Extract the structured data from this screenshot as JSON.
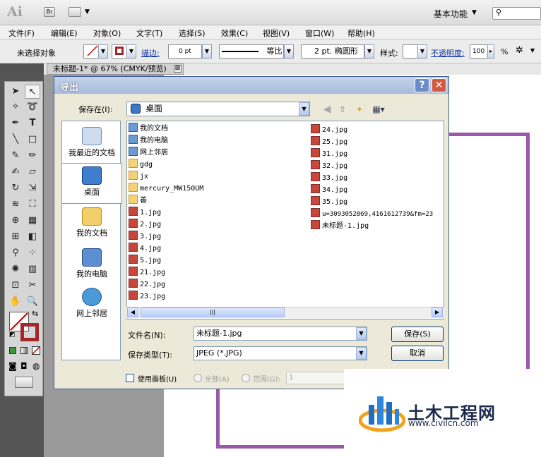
{
  "app": {
    "logo": "Ai",
    "bridge_label": "Br",
    "workspace": "基本功能"
  },
  "menu": [
    "文件(F)",
    "编辑(E)",
    "对象(O)",
    "文字(T)",
    "选择(S)",
    "效果(C)",
    "视图(V)",
    "窗口(W)",
    "帮助(H)"
  ],
  "control": {
    "selection": "未选择对象",
    "stroke_label": "描边:",
    "stroke_value": "0 pt",
    "profile": "等比",
    "brush": "2 pt. 椭圆形",
    "style_label": "样式:",
    "opacity_label": "不透明度:",
    "opacity_value": "100",
    "opacity_unit": "%"
  },
  "document": {
    "tab": "未标题-1* @ 67% (CMYK/预览)",
    "close": "⊠"
  },
  "dialog": {
    "title": "导出",
    "help": "?",
    "close": "✕",
    "save_in_label": "保存在(I):",
    "save_in_value": "桌面",
    "places": [
      {
        "label": "我最近的文档",
        "icon": "recent-docs-icon"
      },
      {
        "label": "桌面",
        "icon": "desktop-icon"
      },
      {
        "label": "我的文档",
        "icon": "my-documents-icon"
      },
      {
        "label": "我的电脑",
        "icon": "my-computer-icon"
      },
      {
        "label": "网上邻居",
        "icon": "network-icon"
      }
    ],
    "files_col1": [
      {
        "name": "我的文档",
        "type": "sys"
      },
      {
        "name": "我的电脑",
        "type": "sys"
      },
      {
        "name": "网上邻居",
        "type": "sys"
      },
      {
        "name": "gdg",
        "type": "folder"
      },
      {
        "name": "jx",
        "type": "folder"
      },
      {
        "name": "mercury_MW150UM",
        "type": "folder"
      },
      {
        "name": "善",
        "type": "folder"
      },
      {
        "name": "1.jpg",
        "type": "jpg"
      },
      {
        "name": "2.jpg",
        "type": "jpg"
      },
      {
        "name": "3.jpg",
        "type": "jpg"
      },
      {
        "name": "4.jpg",
        "type": "jpg"
      },
      {
        "name": "5.jpg",
        "type": "jpg"
      },
      {
        "name": "21.jpg",
        "type": "jpg"
      },
      {
        "name": "22.jpg",
        "type": "jpg"
      },
      {
        "name": "23.jpg",
        "type": "jpg"
      }
    ],
    "files_col2": [
      {
        "name": "24.jpg",
        "type": "jpg"
      },
      {
        "name": "25.jpg",
        "type": "jpg"
      },
      {
        "name": "31.jpg",
        "type": "jpg"
      },
      {
        "name": "32.jpg",
        "type": "jpg"
      },
      {
        "name": "33.jpg",
        "type": "jpg"
      },
      {
        "name": "34.jpg",
        "type": "jpg"
      },
      {
        "name": "35.jpg",
        "type": "jpg"
      },
      {
        "name": "u=3093052869,4161612739&fm=23",
        "type": "jpg"
      },
      {
        "name": "未标题-1.jpg",
        "type": "jpg"
      }
    ],
    "scroll_thumb": "|||",
    "filename_label": "文件名(N):",
    "filename_value": "未标题-1.jpg",
    "filetype_label": "保存类型(T):",
    "filetype_value": "JPEG (*.JPG)",
    "save_button": "保存(S)",
    "cancel_button": "取消",
    "use_artboard": "使用画板(U)",
    "all_label": "全部(A)",
    "range_label": "范围(G):",
    "range_value": "1"
  },
  "watermark": {
    "cn": "土木工程网",
    "url": "www.civilcn.com"
  }
}
